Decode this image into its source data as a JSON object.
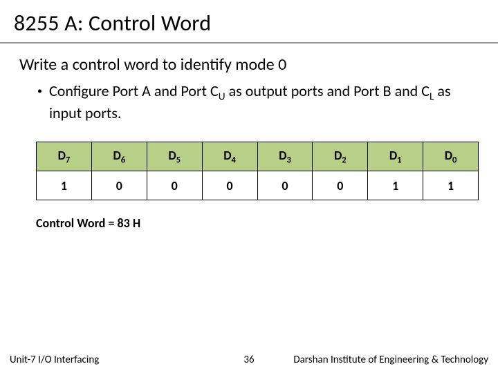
{
  "title": "8255 A: Control Word",
  "subhead": "Write a control word to identify mode 0",
  "bullet": {
    "pre": "Configure Port A and Port C",
    "sub1": "U",
    "mid": " as output ports and Port B and C",
    "sub2": "L",
    "post": " as input ports."
  },
  "table": {
    "headers": [
      {
        "d": "D",
        "s": "7"
      },
      {
        "d": "D",
        "s": "6"
      },
      {
        "d": "D",
        "s": "5"
      },
      {
        "d": "D",
        "s": "4"
      },
      {
        "d": "D",
        "s": "3"
      },
      {
        "d": "D",
        "s": "2"
      },
      {
        "d": "D",
        "s": "1"
      },
      {
        "d": "D",
        "s": "0"
      }
    ],
    "values": [
      "1",
      "0",
      "0",
      "0",
      "0",
      "0",
      "1",
      "1"
    ]
  },
  "result": "Control Word = 83 H",
  "footer": {
    "unit": "Unit-7 I/O Interfacing",
    "page": "36",
    "inst": "Darshan Institute of Engineering & Technology"
  }
}
